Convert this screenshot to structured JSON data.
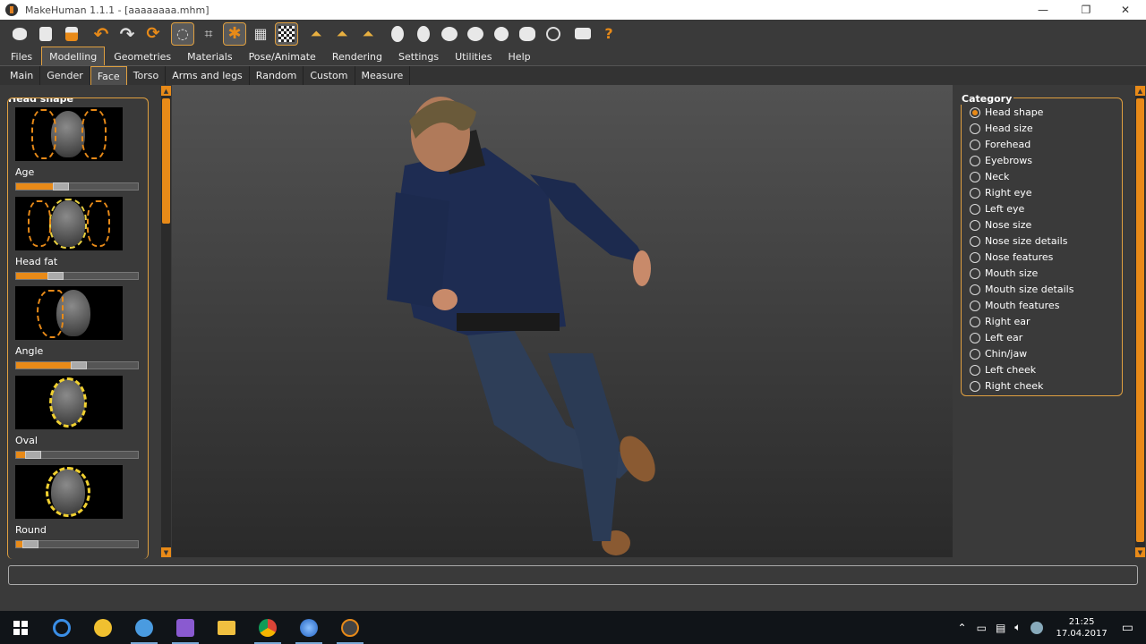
{
  "window": {
    "title": "MakeHuman 1.1.1 - [aaaaaaaa.mhm]",
    "min": "—",
    "restore": "❐",
    "close": "✕"
  },
  "toolbar": {
    "icons": [
      "new-icon",
      "save-icon",
      "export-icon",
      "undo-icon",
      "redo-icon",
      "reset-icon",
      "smooth-icon",
      "wireframe-icon",
      "pose-icon",
      "grid-icon",
      "background-icon",
      "front-view-icon",
      "back-view-icon",
      "side-view-icon",
      "head-front-icon",
      "head-back-icon",
      "head-left-icon",
      "head-right-icon",
      "head-top-icon",
      "head-bottom-icon",
      "head-reset-icon",
      "screenshot-icon",
      "help-icon"
    ]
  },
  "menu": {
    "tabs": [
      "Files",
      "Modelling",
      "Geometries",
      "Materials",
      "Pose/Animate",
      "Rendering",
      "Settings",
      "Utilities",
      "Help"
    ],
    "active": "Modelling"
  },
  "subtabs": {
    "tabs": [
      "Main",
      "Gender",
      "Face",
      "Torso",
      "Arms and legs",
      "Random",
      "Custom",
      "Measure"
    ],
    "active": "Face"
  },
  "left_panel": {
    "title": "Head shape",
    "modifiers": [
      {
        "label": "Age",
        "value": 0.33
      },
      {
        "label": "Head fat",
        "value": 0.29
      },
      {
        "label": "Angle",
        "value": 0.48
      },
      {
        "label": "Oval",
        "value": 0.1
      },
      {
        "label": "Round",
        "value": 0.08
      }
    ]
  },
  "right_panel": {
    "title": "Category",
    "selected": "Head shape",
    "items": [
      "Head shape",
      "Head size",
      "Forehead",
      "Eyebrows",
      "Neck",
      "Right eye",
      "Left eye",
      "Nose size",
      "Nose size details",
      "Nose features",
      "Mouth size",
      "Mouth size details",
      "Mouth features",
      "Right ear",
      "Left ear",
      "Chin/jaw",
      "Left cheek",
      "Right cheek"
    ]
  },
  "taskbar": {
    "apps": [
      "start-icon",
      "cortana-icon",
      "explorer-app-icon",
      "browser-app-icon",
      "visual-studio-icon",
      "file-explorer-icon",
      "chrome-icon",
      "globe-app-icon",
      "makehuman-app-icon"
    ],
    "time": "21:25",
    "date": "17.04.2017"
  },
  "colors": {
    "accent": "#e88a18",
    "panel_border": "#e0a040",
    "background": "#3a3a3a"
  }
}
